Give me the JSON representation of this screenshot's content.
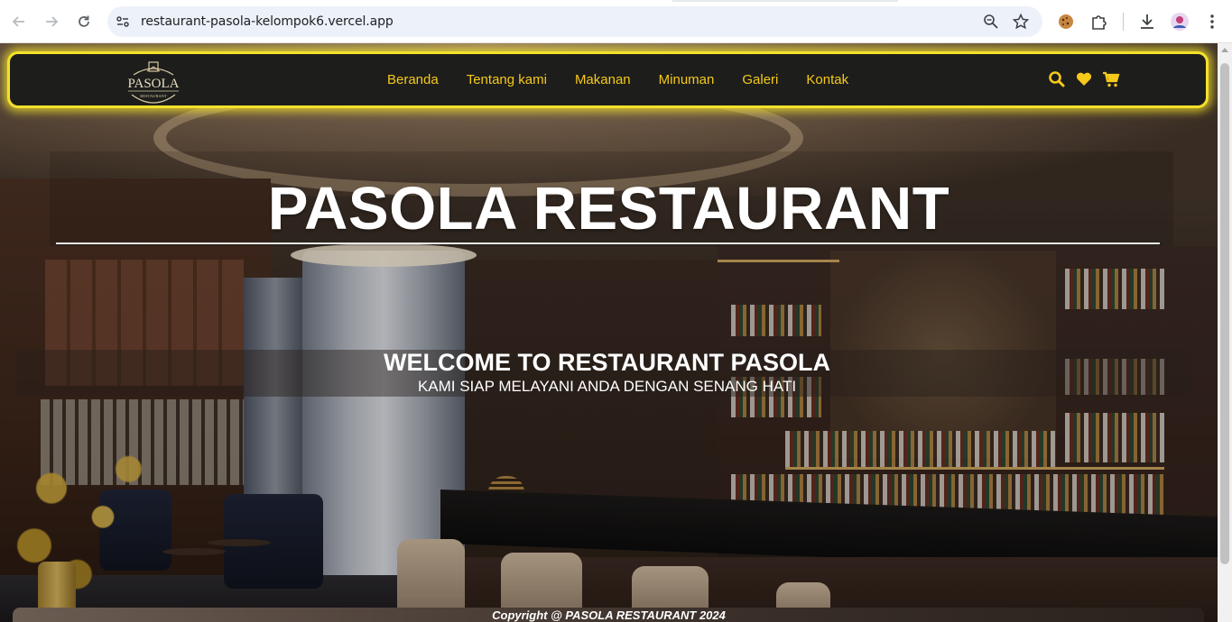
{
  "browser": {
    "url": "restaurant-pasola-kelompok6.vercel.app",
    "icons": [
      "back-icon",
      "forward-icon",
      "reload-icon",
      "site-info-icon",
      "zoom-icon",
      "bookmark-star-icon",
      "cookie-extension-icon",
      "extensions-puzzle-icon",
      "download-icon",
      "profile-avatar",
      "more-menu-icon"
    ]
  },
  "site": {
    "logo": {
      "text": "PASOLA",
      "subtext": "RESTAURANT"
    },
    "nav": {
      "items": [
        "Beranda",
        "Tentang kami",
        "Makanan",
        "Minuman",
        "Galeri",
        "Kontak"
      ],
      "actions": [
        "search-icon",
        "heart-icon",
        "cart-icon"
      ]
    },
    "hero": {
      "title": "PASOLA RESTAURANT",
      "welcome": "WELCOME TO RESTAURANT PASOLA",
      "subtitle": "KAMI SIAP MELAYANI ANDA DENGAN SENANG HATI"
    },
    "footer": {
      "copyright": "Copyright @ PASOLA RESTAURANT 2024"
    }
  },
  "colors": {
    "nav_bg": "#1d1e1c",
    "nav_border": "#f4e12a",
    "nav_link": "#f6c91a",
    "hero_text": "#ffffff"
  }
}
